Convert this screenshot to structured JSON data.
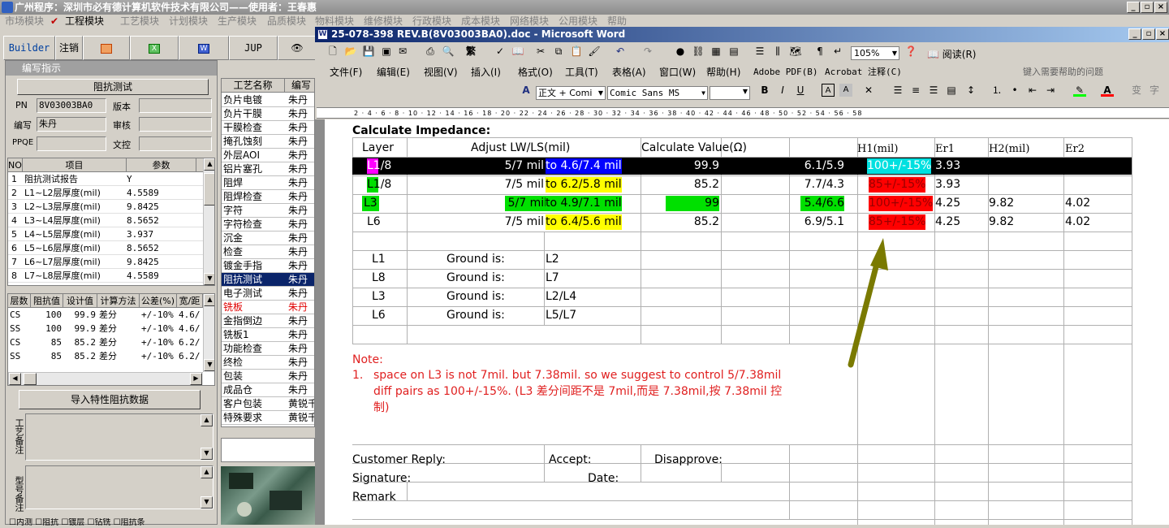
{
  "app_title": "广州程序：深圳市必有德计算机软件技术有限公司——使用者：王春惠",
  "main_menu": [
    "市场模块",
    "工程模块",
    "工艺模块",
    "计划模块",
    "生产模块",
    "品质模块",
    "物料模块",
    "维修模块",
    "行政模块",
    "成本模块",
    "网络模块",
    "公用模块",
    "帮助"
  ],
  "toolbar2": [
    "Builder",
    "注销",
    "JUP"
  ],
  "panel_title": "编写指示",
  "impedance_btn": "阻抗测试",
  "form": {
    "pn_label": "PN",
    "pn": "8V03003BA0",
    "version_label": "版本",
    "version": "",
    "writer_label": "编写",
    "writer": "朱丹",
    "review_label": "审核",
    "review": "",
    "ppqe_label": "PPQE",
    "ppqe": "",
    "doc_label": "文控",
    "doc": ""
  },
  "param_grid": {
    "headers": [
      "NO",
      "项目",
      "参数"
    ],
    "rows": [
      [
        "1",
        "阻抗测试报告",
        "Y"
      ],
      [
        "2",
        "L1~L2层厚度(mil)",
        "4.5589"
      ],
      [
        "3",
        "L2~L3层厚度(mil)",
        "9.8425"
      ],
      [
        "4",
        "L3~L4层厚度(mil)",
        "8.5652"
      ],
      [
        "5",
        "L4~L5层厚度(mil)",
        "3.937"
      ],
      [
        "6",
        "L5~L6层厚度(mil)",
        "8.5652"
      ],
      [
        "7",
        "L6~L7层厚度(mil)",
        "9.8425"
      ],
      [
        "8",
        "L7~L8层厚度(mil)",
        "4.5589"
      ]
    ]
  },
  "imp_grid": {
    "headers": [
      "层数",
      "阻抗值",
      "设计值",
      "计算方法",
      "公差(%)",
      "宽/距"
    ],
    "rows": [
      [
        "CS",
        "100",
        "99.9",
        "差分",
        "+/-10%",
        "4.6/"
      ],
      [
        "SS",
        "100",
        "99.9",
        "差分",
        "+/-10%",
        "4.6/"
      ],
      [
        "CS",
        "85",
        "85.2",
        "差分",
        "+/-10%",
        "6.2/"
      ],
      [
        "SS",
        "85",
        "85.2",
        "差分",
        "+/-10%",
        "6.2/"
      ]
    ]
  },
  "import_btn": "导入特性阻抗数据",
  "note1_label": "工艺备注",
  "note2_label": "型号备注",
  "bottom_checks": [
    "内测",
    "阻抗",
    "镀层",
    "钻铣",
    "阻抗条"
  ],
  "process_list": {
    "headers": [
      "工艺名称",
      "编写"
    ],
    "rows": [
      [
        "负片电镀",
        "朱丹"
      ],
      [
        "负片干膜",
        "朱丹"
      ],
      [
        "干膜检查",
        "朱丹"
      ],
      [
        "掩孔蚀刻",
        "朱丹"
      ],
      [
        "外层AOI",
        "朱丹"
      ],
      [
        "铝片塞孔",
        "朱丹"
      ],
      [
        "阻焊",
        "朱丹"
      ],
      [
        "阻焊检查",
        "朱丹"
      ],
      [
        "字符",
        "朱丹"
      ],
      [
        "字符检查",
        "朱丹"
      ],
      [
        "沉金",
        "朱丹"
      ],
      [
        "检查",
        "朱丹"
      ],
      [
        "镀金手指",
        "朱丹"
      ],
      [
        "阻抗测试",
        "朱丹"
      ],
      [
        "电子测试",
        "朱丹"
      ],
      [
        "铣板",
        "朱丹"
      ],
      [
        "金指倒边",
        "朱丹"
      ],
      [
        "铣板1",
        "朱丹"
      ],
      [
        "功能检查",
        "朱丹"
      ],
      [
        "终检",
        "朱丹"
      ],
      [
        "包装",
        "朱丹"
      ],
      [
        "成品仓",
        "朱丹"
      ],
      [
        "客户包装",
        "黄锐千"
      ],
      [
        "特殊要求",
        "黄锐千"
      ]
    ],
    "selected": 13,
    "red": 15
  },
  "word": {
    "title": "25-078-398 REV.B(8V03003BA0).doc - Microsoft Word",
    "zoom": "105%",
    "read_label": "阅读(R)",
    "menu": [
      "文件(F)",
      "编辑(E)",
      "视图(V)",
      "插入(I)",
      "格式(O)",
      "工具(T)",
      "表格(A)",
      "窗口(W)",
      "帮助(H)",
      "Adobe PDF(B)",
      "Acrobat 注释(C)"
    ],
    "help_placeholder": "键入需要帮助的问题",
    "style": "正文 + Comi",
    "font": "Comic Sans MS",
    "ruler": "2 · 4 · 6 · 8 · 10 · 12 · 14 · 16 · 18 · 20 · 22 · 24 · 26 · 28 · 30 · 32 · 34 · 36 · 38 · 40 · 42 · 44 · 46 · 48 · 50 · 52 · 54 · 56 · 58"
  },
  "doc": {
    "heading": "Calculate Impedance:",
    "th": [
      "Layer",
      "Adjust LW/LS(mil)",
      "Calculate Value(Ω)",
      "H1(mil)",
      "Er1",
      "H2(mil)",
      "Er2"
    ],
    "rows": [
      {
        "layer": "L1/8",
        "adj": "5/7 mil",
        "to": "to  4.6/7.4 mil",
        "calc": "99.9",
        "lwls": "6.1/5.9",
        "tol": "100+/-15%",
        "er1": "3.93",
        "h2": "",
        "er2": ""
      },
      {
        "layer": "L1/8",
        "adj": "7/5 mil",
        "to": "to  6.2/5.8 mil",
        "calc": "85.2",
        "lwls": "7.7/4.3",
        "tol": "85+/-15%",
        "er1": "3.93",
        "h2": "",
        "er2": ""
      },
      {
        "layer": "L3",
        "adj": "5/7 mil",
        "to": "to  4.9/7.1 mil",
        "calc": "99",
        "lwls": "5.4/6.6",
        "tol": "100+/-15%",
        "er1": "4.25",
        "h2": "9.82",
        "er2": "4.02"
      },
      {
        "layer": "L6",
        "adj": "7/5 mil",
        "to": "to  6.4/5.6 mil",
        "calc": "85.2",
        "lwls": "6.9/5.1",
        "tol": "85+/-15%",
        "er1": "4.25",
        "h2": "9.82",
        "er2": "4.02"
      }
    ],
    "ground": [
      [
        "L1",
        "Ground is:",
        "L2"
      ],
      [
        "L8",
        "Ground is:",
        "L7"
      ],
      [
        "L3",
        "Ground is:",
        "L2/L4"
      ],
      [
        "L6",
        "Ground is:",
        "L5/L7"
      ]
    ],
    "note_title": "Note:",
    "note_num": "1.",
    "note_line1": "space on L3 is not 7mil.  but 7.38mil. so we suggest to control 5/7.38mil",
    "note_line2": "diff pairs as 100+/-15%.  (L3 差分间距不是 7mil,而是 7.38mil,按 7.38mil 控",
    "note_line3": "制)",
    "reply_label": "Customer Reply:",
    "accept_label": "Accept:",
    "disapprove_label": "Disapprove:",
    "signature_label": "Signature:",
    "date_label": "Date:",
    "remark_label": "Remark"
  }
}
